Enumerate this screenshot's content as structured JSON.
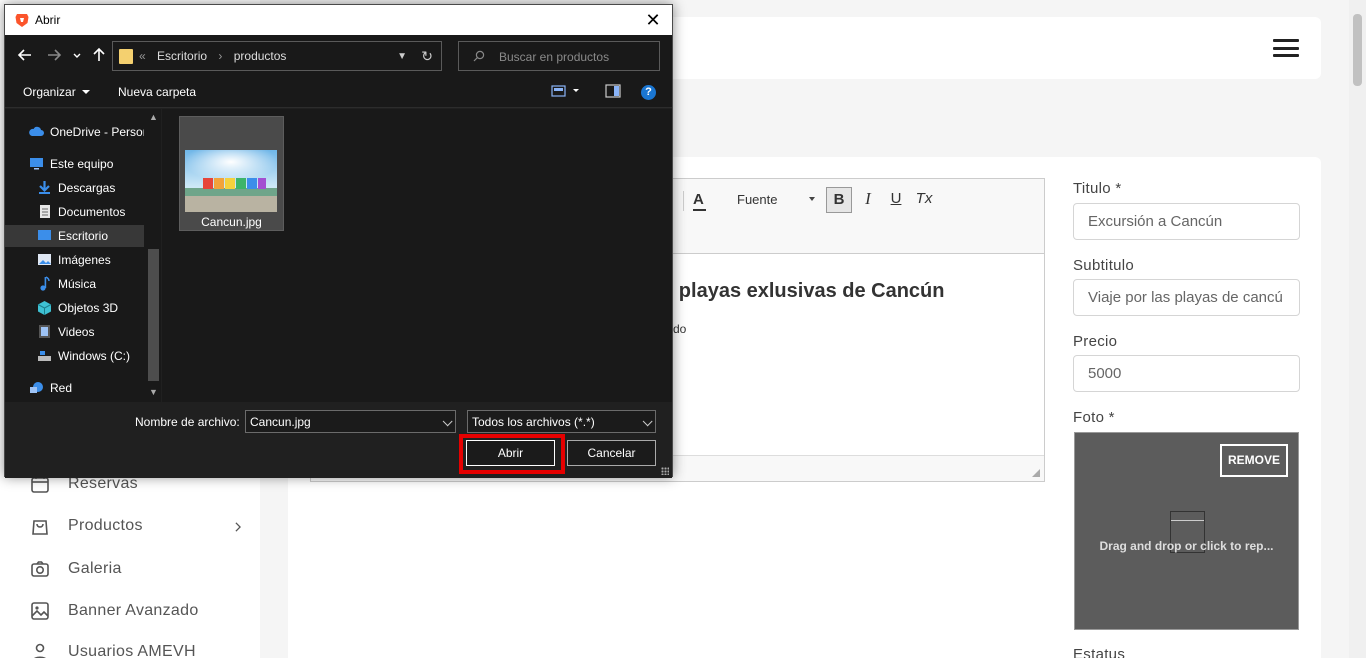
{
  "sidebar": {
    "items": [
      {
        "label": "Reservas",
        "icon": "calendar-icon"
      },
      {
        "label": "Productos",
        "icon": "bag-icon"
      },
      {
        "label": "Galeria",
        "icon": "camera-icon"
      },
      {
        "label": "Banner Avanzado",
        "icon": "image-icon"
      },
      {
        "label": "Usuarios AMEVH",
        "icon": "user-icon"
      }
    ]
  },
  "editor": {
    "font_color_label": "A",
    "font_label": "Fuente",
    "bold": "B",
    "italic": "I",
    "underline": "U",
    "clear_format": "Tx",
    "heading": "as playas exlusivas de Cancún",
    "body_fragment": "do"
  },
  "form": {
    "titulo_label": "Titulo *",
    "titulo_value": "Excursión a Cancún",
    "subtitulo_label": "Subtitulo",
    "subtitulo_value": "Viaje por las playas de cancú",
    "precio_label": "Precio",
    "precio_value": "5000",
    "foto_label": "Foto *",
    "remove_label": "REMOVE",
    "dropzone_text": "Drag and drop or click to rep...",
    "estatus_label": "Estatus"
  },
  "dialog": {
    "title": "Abrir",
    "breadcrumb": [
      "«",
      "Escritorio",
      "›",
      "productos"
    ],
    "search_placeholder": "Buscar en productos",
    "organize_label": "Organizar",
    "new_folder_label": "Nueva carpeta",
    "help_label": "?",
    "tree": [
      {
        "label": "OneDrive - Persor",
        "icon": "cloud-icon",
        "indent": 1
      },
      {
        "label": "Este equipo",
        "icon": "computer-icon",
        "indent": 1
      },
      {
        "label": "Descargas",
        "icon": "download-icon",
        "indent": 2
      },
      {
        "label": "Documentos",
        "icon": "document-icon",
        "indent": 2
      },
      {
        "label": "Escritorio",
        "icon": "desktop-icon",
        "indent": 2,
        "selected": true
      },
      {
        "label": "Imágenes",
        "icon": "pictures-icon",
        "indent": 2
      },
      {
        "label": "Música",
        "icon": "music-icon",
        "indent": 2
      },
      {
        "label": "Objetos 3D",
        "icon": "cube-icon",
        "indent": 2
      },
      {
        "label": "Videos",
        "icon": "video-icon",
        "indent": 2
      },
      {
        "label": "Windows (C:)",
        "icon": "drive-icon",
        "indent": 2
      },
      {
        "label": "Red",
        "icon": "network-icon",
        "indent": 1
      }
    ],
    "files": [
      {
        "name": "Cancun.jpg"
      }
    ],
    "filename_label": "Nombre de archivo:",
    "filename_value": "Cancun.jpg",
    "filetype_value": "Todos los archivos (*.*)",
    "open_label": "Abrir",
    "cancel_label": "Cancelar"
  },
  "colors": {
    "dialog_bg": "#202020",
    "highlight": "#e60000",
    "selected_item": "#383838",
    "help_blue": "#1a76d2"
  }
}
